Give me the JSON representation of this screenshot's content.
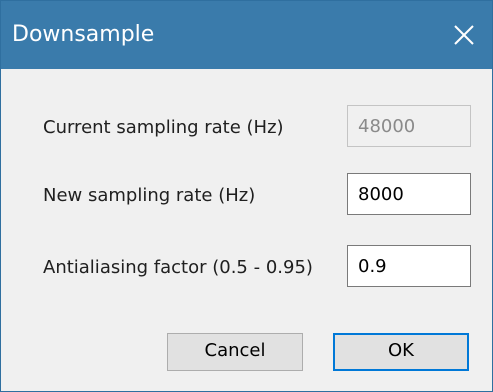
{
  "window": {
    "title": "Downsample"
  },
  "form": {
    "current_rate": {
      "label": "Current sampling rate (Hz)",
      "value": "48000"
    },
    "new_rate": {
      "label": "New sampling rate (Hz)",
      "value": "8000"
    },
    "antialiasing": {
      "label": "Antialiasing factor (0.5 - 0.95)",
      "value": "0.9"
    }
  },
  "buttons": {
    "cancel_label": "Cancel",
    "ok_label": "OK"
  },
  "colors": {
    "titlebar": "#3a7bab",
    "default_button_border": "#0078d7"
  },
  "icons": {
    "close": "close-icon"
  }
}
